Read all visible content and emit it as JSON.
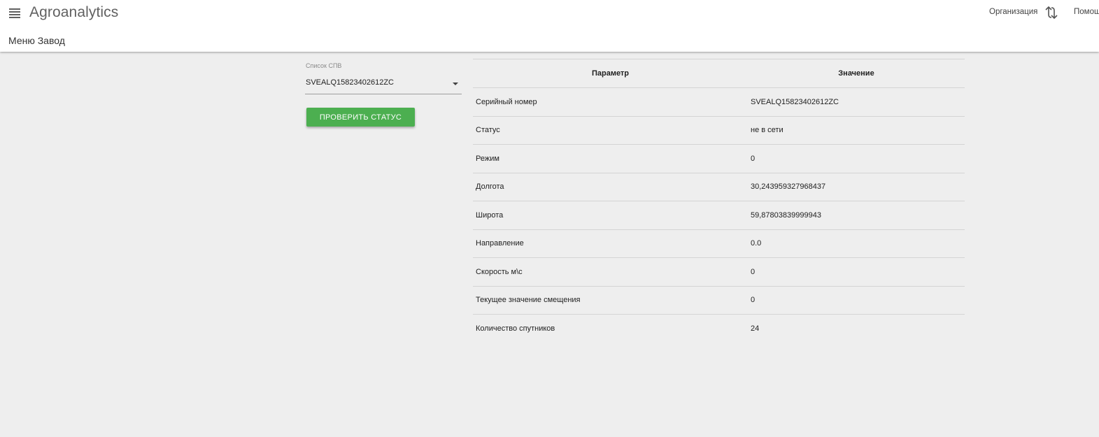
{
  "header": {
    "app_title": "Agroanalytics",
    "subnav_label": "Меню Завод",
    "organization_label": "Организация",
    "help_label": "Помощь"
  },
  "form": {
    "select_label": "Список СПВ",
    "select_value": "SVEALQ15823402612ZC",
    "check_button_label": "ПРОВЕРИТЬ СТАТУС"
  },
  "table": {
    "headers": [
      "Параметр",
      "Значение"
    ],
    "rows": [
      {
        "param": "Серийный номер",
        "value": "SVEALQ15823402612ZC"
      },
      {
        "param": "Статус",
        "value": "не в сети"
      },
      {
        "param": "Режим",
        "value": "0"
      },
      {
        "param": "Долгота",
        "value": "30,243959327968437"
      },
      {
        "param": "Широта",
        "value": "59,87803839999943"
      },
      {
        "param": "Направление",
        "value": "0.0"
      },
      {
        "param": "Скорость м\\с",
        "value": "0"
      },
      {
        "param": "Текущее значение смещения",
        "value": "0"
      },
      {
        "param": "Количество спутников",
        "value": "24"
      }
    ]
  },
  "colors": {
    "accent_button": "#4caf50",
    "background": "#eeeeee"
  },
  "icons": {
    "menu": "hamburger-menu-icon",
    "swap": "swap-arrows-icon",
    "dropdown": "caret-down-icon"
  }
}
